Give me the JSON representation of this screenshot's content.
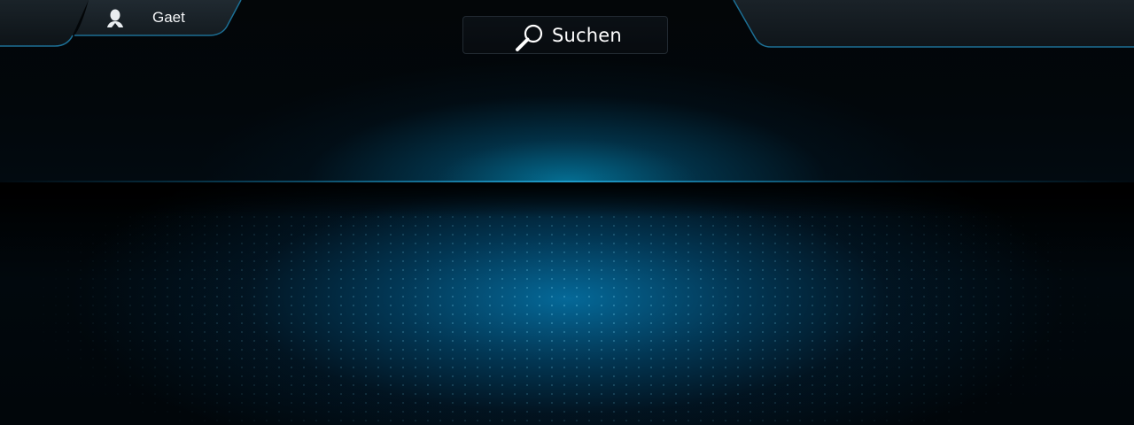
{
  "profile": {
    "name": "Gaet",
    "icon": "user-icon"
  },
  "search": {
    "label": "Suchen",
    "icon": "search-icon"
  },
  "colors": {
    "accent_glow": "#0580aa",
    "tab_edge": "#1c6f95",
    "text": "#ffffff"
  }
}
